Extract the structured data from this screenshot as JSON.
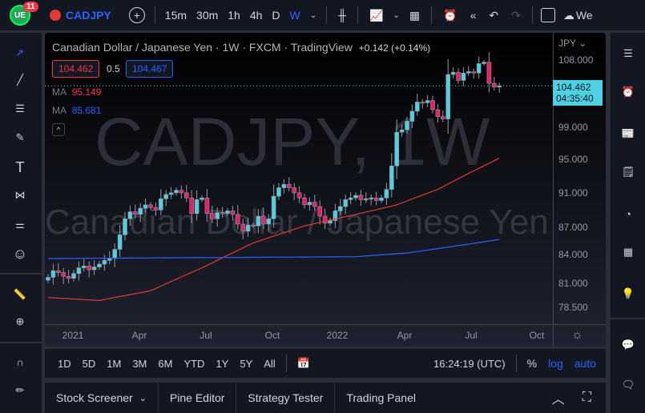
{
  "topbar": {
    "badge": "11",
    "symbol": "CADJPY",
    "intervals": [
      "15m",
      "30m",
      "1h",
      "4h",
      "D",
      "W"
    ],
    "active_interval": "W",
    "cloud_label": "We"
  },
  "legend": {
    "title": "Canadian Dollar / Japanese Yen · 1W · FXCM · TradingView",
    "change": "+0.142 (+0.14%)",
    "bid": "104.462",
    "spread": "0.5",
    "ask": "104.467",
    "ma1_label": "MA",
    "ma1_value": "95.149",
    "ma2_label": "MA",
    "ma2_value": "85.681"
  },
  "watermark": {
    "line1": "CADJPY, 1W",
    "line2": "Canadian Dollar / Japanese Yen"
  },
  "price_axis": {
    "currency": "JPY",
    "ticks": [
      "108.000",
      "99.000",
      "95.000",
      "91.000",
      "87.000",
      "84.000",
      "81.000",
      "78.500"
    ],
    "last_price": "104.462",
    "countdown": "04:35:40"
  },
  "time_axis": {
    "ticks": [
      "2021",
      "Apr",
      "Jul",
      "Oct",
      "2022",
      "Apr",
      "Jul",
      "Oct"
    ]
  },
  "bottombar": {
    "ranges": [
      "1D",
      "5D",
      "1M",
      "3M",
      "6M",
      "YTD",
      "1Y",
      "5Y",
      "All"
    ],
    "clock": "16:24:19 (UTC)",
    "percent": "%",
    "log": "log",
    "auto": "auto"
  },
  "tabs": [
    "Stock Screener",
    "Pine Editor",
    "Strategy Tester",
    "Trading Panel"
  ],
  "colors": {
    "up": "#4dd0e1",
    "down": "#e91e63",
    "ma1": "#e53935",
    "ma2": "#2962ff",
    "accent": "#2962ff"
  },
  "chart_data": {
    "type": "candlestick",
    "title": "CADJPY, 1W",
    "ylabel": "JPY",
    "ylim": [
      77.5,
      110
    ],
    "scale": "log",
    "closes": [
      81.6,
      82.3,
      82.1,
      81.7,
      81.5,
      82.0,
      82.6,
      82.8,
      82.4,
      82.7,
      83.0,
      83.4,
      83.6,
      84.6,
      86.2,
      88.0,
      88.8,
      88.5,
      89.2,
      89.6,
      89.3,
      89.0,
      90.3,
      90.8,
      91.0,
      91.3,
      91.0,
      90.4,
      88.6,
      90.2,
      90.4,
      88.6,
      88.0,
      88.7,
      88.6,
      88.9,
      88.5,
      87.4,
      86.6,
      87.3,
      87.2,
      88.3,
      87.4,
      88.0,
      90.6,
      91.6,
      92.0,
      91.6,
      91.0,
      90.4,
      89.6,
      89.9,
      89.4,
      88.3,
      87.5,
      87.8,
      88.9,
      89.4,
      90.2,
      90.4,
      90.7,
      90.2,
      90.3,
      90.4,
      90.1,
      90.4,
      91.4,
      94.2,
      98.4,
      98.7,
      99.8,
      101.1,
      102.3,
      102.2,
      102.5,
      101.3,
      100.4,
      100.1,
      106.0,
      106.3,
      105.2,
      106.2,
      106.4,
      106.2,
      107.5,
      107.7,
      104.8,
      104.3,
      104.462
    ],
    "ma1": [
      [
        0,
        79.5
      ],
      [
        10,
        79.2
      ],
      [
        20,
        80.2
      ],
      [
        30,
        82.6
      ],
      [
        40,
        85.3
      ],
      [
        50,
        87.2
      ],
      [
        60,
        88.5
      ],
      [
        68,
        89.6
      ],
      [
        76,
        91.4
      ],
      [
        82,
        93.3
      ],
      [
        88,
        95.149
      ]
    ],
    "ma2": [
      [
        0,
        83.6
      ],
      [
        30,
        83.7
      ],
      [
        60,
        83.8
      ],
      [
        70,
        84.2
      ],
      [
        80,
        85.0
      ],
      [
        88,
        85.681
      ]
    ]
  }
}
